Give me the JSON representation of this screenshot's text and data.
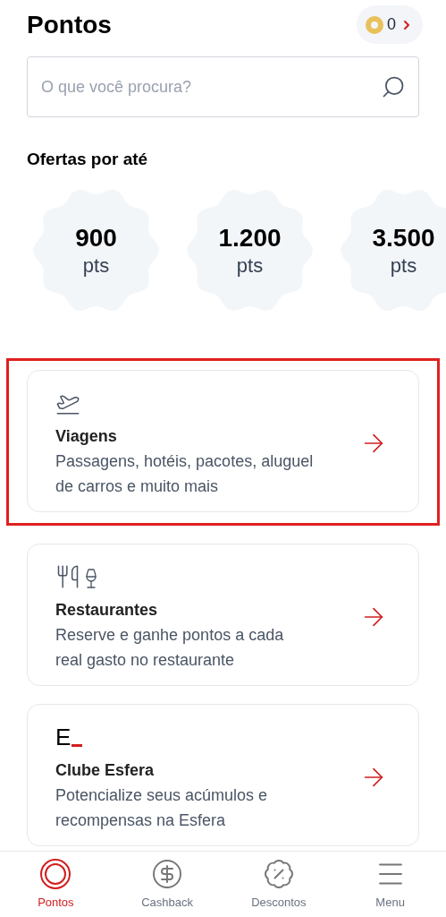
{
  "header": {
    "title": "Pontos",
    "points_badge": {
      "value": "0"
    }
  },
  "search": {
    "placeholder": "O que você procura?"
  },
  "offers": {
    "title": "Ofertas por até",
    "items": [
      {
        "value": "900",
        "unit": "pts"
      },
      {
        "value": "1.200",
        "unit": "pts"
      },
      {
        "value": "3.500",
        "unit": "pts"
      }
    ]
  },
  "categories": [
    {
      "kind": "plane",
      "title": "Viagens",
      "description": "Passagens, hotéis, pacotes, aluguel de carros e muito mais",
      "highlighted": true
    },
    {
      "kind": "dining",
      "title": "Restaurantes",
      "description": "Reserve e ganhe pontos a cada real gasto no restaurante",
      "highlighted": false
    },
    {
      "kind": "logo",
      "logo_text": "E",
      "title": "Clube Esfera",
      "description": "Potencialize seus acúmulos e recompensas na Esfera",
      "highlighted": false
    }
  ],
  "bottom_nav": [
    {
      "kind": "rings",
      "label": "Pontos",
      "selected": true
    },
    {
      "kind": "cashback",
      "label": "Cashback",
      "selected": false
    },
    {
      "kind": "discount",
      "label": "Descontos",
      "selected": false
    },
    {
      "kind": "menu",
      "label": "Menu",
      "selected": false
    }
  ]
}
